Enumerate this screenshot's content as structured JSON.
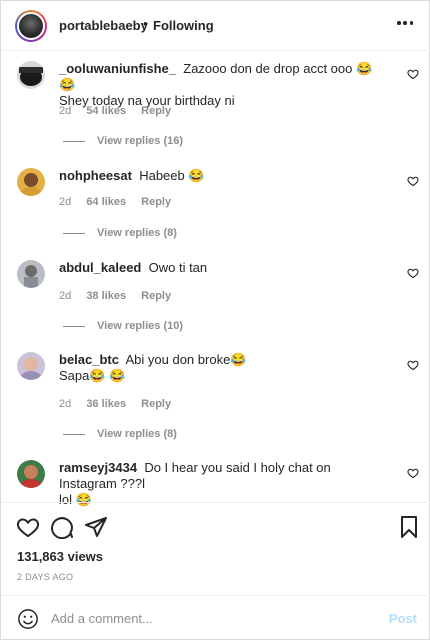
{
  "header": {
    "username": "portablebaeby",
    "separator": "•",
    "follow_status": "Following"
  },
  "comments": [
    {
      "username": "_ooluwaniunfishe_",
      "text_line1": "Zazooo don de drop acct ooo 😂 😂",
      "text_line2": "Shey today na your birthday ni",
      "time": "2d",
      "likes": "54 likes",
      "reply": "Reply",
      "view_replies": "View replies (16)"
    },
    {
      "username": "nohpheesat",
      "text_line1": "Habeeb 😂",
      "time": "2d",
      "likes": "64 likes",
      "reply": "Reply",
      "view_replies": "View replies (8)"
    },
    {
      "username": "abdul_kaleed",
      "text_line1": "Owo ti tan",
      "time": "2d",
      "likes": "38 likes",
      "reply": "Reply",
      "view_replies": "View replies (10)"
    },
    {
      "username": "belac_btc",
      "text_line1": "Abi you don broke😂",
      "text_line2": "Sapa😂 😂",
      "time": "2d",
      "likes": "36 likes",
      "reply": "Reply",
      "view_replies": "View replies (8)"
    },
    {
      "username": "ramseyj3434",
      "text_line1": "Do I hear you said I holy chat on Instagram ???l",
      "text_line2": "lol 😂"
    }
  ],
  "stats": {
    "views": "131,863 views",
    "posted": "2 DAYS AGO"
  },
  "add_comment": {
    "placeholder": "Add a comment...",
    "post_label": "Post"
  },
  "icons": {
    "like": "heart-icon",
    "comment": "comment-icon",
    "share": "share-icon",
    "save": "bookmark-icon",
    "emoji": "emoji-icon",
    "more": "more-icon"
  },
  "colors": {
    "text": "#262626",
    "muted": "#8e8e8e",
    "post_disabled": "#b2dffc",
    "laugh_emoji": "#f7c21e"
  }
}
